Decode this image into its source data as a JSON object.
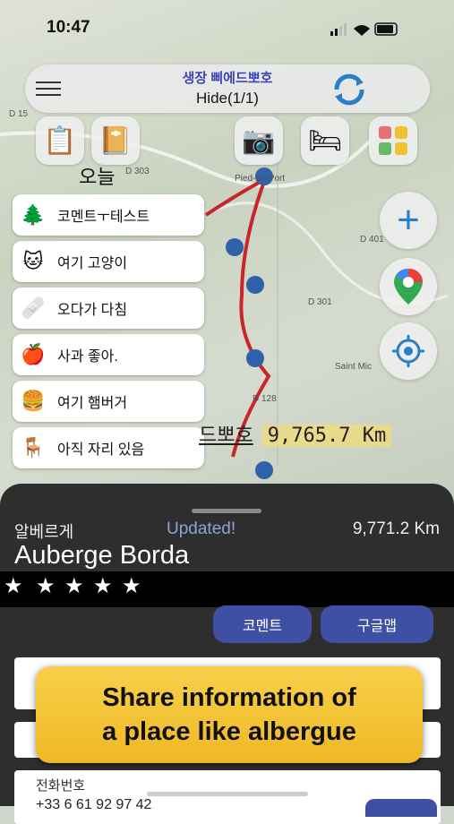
{
  "status_bar": {
    "time": "10:47"
  },
  "header": {
    "subtitle": "생장 삐에드뽀호",
    "title": "Hide(1/1)"
  },
  "today_label": "오늘",
  "categories": [
    {
      "label": "코멘트ㅜ테스트",
      "icon": "people-icon"
    },
    {
      "label": "여기 고양이",
      "icon": "cat-icon"
    },
    {
      "label": "오다가 다침",
      "icon": "bandage-icon"
    },
    {
      "label": "사과 좋아.",
      "icon": "apple-icon"
    },
    {
      "label": "여기 햄버거",
      "icon": "burger-icon"
    },
    {
      "label": "아직 자리 있음",
      "icon": "bench-icon"
    }
  ],
  "map": {
    "place_labels": [
      "Pied-de-Port",
      "D 401",
      "D 301",
      "Saint Mic",
      "D 15",
      "D 303",
      "D 128"
    ],
    "marker_label": "드뽀호",
    "marker_distance": "9,765.7 Km"
  },
  "place": {
    "korean_name": "알베르게",
    "updated": "Updated!",
    "distance": "9,771.2 Km",
    "name": "Auberge Borda",
    "rating_stars": 5
  },
  "buttons": {
    "comment": "코멘트",
    "google_map": "구글맵"
  },
  "fields": {
    "phone_label": "전화번호",
    "phone_value": "+33 6 61 92 97 42"
  },
  "promo": {
    "line1": "Share information of",
    "line2": "a place like albergue"
  },
  "colors": {
    "accent": "#3f50a4",
    "route": "#c8262a",
    "banner": "#f2c133"
  }
}
